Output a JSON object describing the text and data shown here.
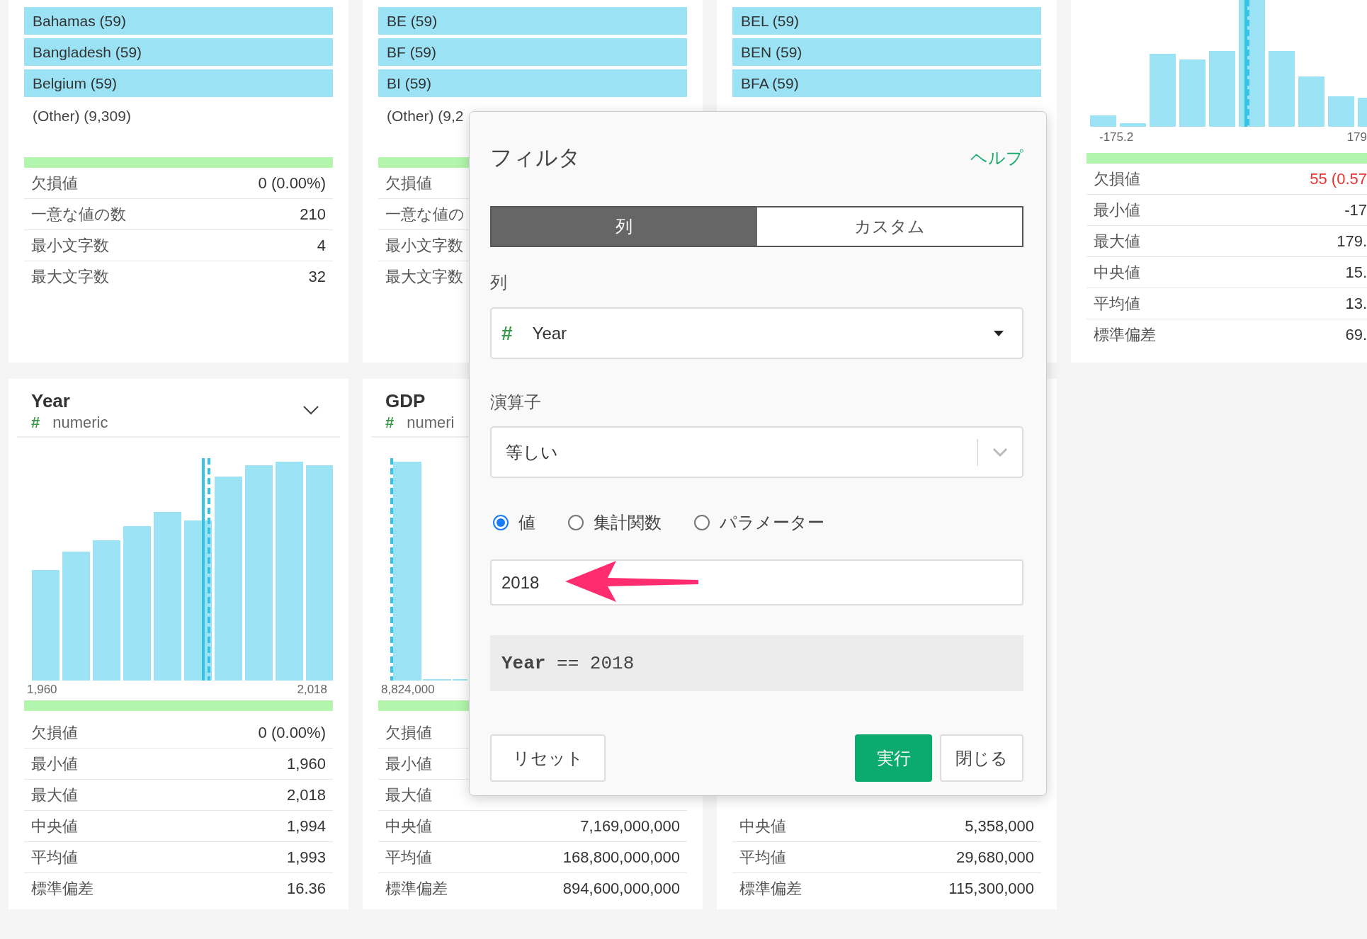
{
  "columns": [
    {
      "top": {
        "kind": "category",
        "bars": [
          "Bahamas (59)",
          "Bangladesh (59)",
          "Belgium (59)"
        ],
        "other": "(Other) (9,309)",
        "stats": [
          {
            "label": "欠損値",
            "value": "0 (0.00%)",
            "alert": false
          },
          {
            "label": "一意な値の数",
            "value": "210",
            "alert": false
          },
          {
            "label": "最小文字数",
            "value": "4",
            "alert": false
          },
          {
            "label": "最大文字数",
            "value": "32",
            "alert": false
          }
        ]
      },
      "bottom": {
        "kind": "numeric",
        "title": "Year",
        "type_icon": "#",
        "type": "numeric",
        "ticks": [
          "1,960",
          "2,018"
        ],
        "stats": [
          {
            "label": "欠損値",
            "value": "0 (0.00%)",
            "alert": false
          },
          {
            "label": "最小値",
            "value": "1,960",
            "alert": false
          },
          {
            "label": "最大値",
            "value": "2,018",
            "alert": false
          },
          {
            "label": "中央値",
            "value": "1,994",
            "alert": false
          },
          {
            "label": "平均値",
            "value": "1,993",
            "alert": false
          },
          {
            "label": "標準偏差",
            "value": "16.36",
            "alert": false
          }
        ]
      }
    },
    {
      "top": {
        "kind": "category",
        "bars": [
          "BE (59)",
          "BF (59)",
          "BI (59)"
        ],
        "other": "(Other) (9,2",
        "stats": [
          {
            "label": "欠損値"
          },
          {
            "label": "一意な値の"
          },
          {
            "label": "最小文字数"
          },
          {
            "label": "最大文字数"
          }
        ]
      },
      "bottom": {
        "kind": "numeric",
        "title": "GDP",
        "type_icon": "#",
        "type": "numeri",
        "ticks": [
          "8,824,000"
        ],
        "stats": [
          {
            "label": "欠損値"
          },
          {
            "label": "最小値"
          },
          {
            "label": "最大値"
          },
          {
            "label": "中央値",
            "value": "7,169,000,000",
            "alert": false
          },
          {
            "label": "平均値",
            "value": "168,800,000,000",
            "alert": false
          },
          {
            "label": "標準偏差",
            "value": "894,600,000,000",
            "alert": false
          }
        ]
      }
    },
    {
      "top": {
        "kind": "category",
        "bars": [
          "BEL (59)",
          "BEN (59)",
          "BFA (59)"
        ]
      },
      "bottom": {
        "kind": "numeric",
        "stats": [
          {
            "label": "中央値",
            "value": "5,358,000",
            "alert": false
          },
          {
            "label": "平均値",
            "value": "29,680,000",
            "alert": false
          },
          {
            "label": "標準偏差",
            "value": "115,300,000",
            "alert": false
          }
        ]
      }
    },
    {
      "top": {
        "kind": "numeric",
        "ticks": [
          "-175.2",
          "179"
        ],
        "stats": [
          {
            "label": "欠損値",
            "value": "55 (0.57",
            "alert": true
          },
          {
            "label": "最小値",
            "value": "-17",
            "alert": false
          },
          {
            "label": "最大値",
            "value": "179.",
            "alert": false
          },
          {
            "label": "中央値",
            "value": "15.",
            "alert": false
          },
          {
            "label": "平均値",
            "value": "13.",
            "alert": false
          },
          {
            "label": "標準偏差",
            "value": "69.",
            "alert": false
          }
        ]
      }
    }
  ],
  "dialog": {
    "title": "フィルタ",
    "help": "ヘルプ",
    "tabs": [
      {
        "label": "列",
        "selected": true
      },
      {
        "label": "カスタム",
        "selected": false
      }
    ],
    "column_label": "列",
    "column_select": {
      "type_icon": "#",
      "value": "Year"
    },
    "operator_label": "演算子",
    "operator_select": {
      "value": "等しい"
    },
    "modes": [
      {
        "label": "値",
        "selected": true
      },
      {
        "label": "集計関数",
        "selected": false
      },
      {
        "label": "パラメーター",
        "selected": false
      }
    ],
    "value_input": {
      "value": "2018"
    },
    "expression": "**Year** == 2018",
    "buttons": [
      {
        "label": "リセット",
        "kind": "secondary"
      },
      {
        "label": "実行",
        "kind": "primary"
      },
      {
        "label": "閉じる",
        "kind": "secondary"
      }
    ]
  }
}
